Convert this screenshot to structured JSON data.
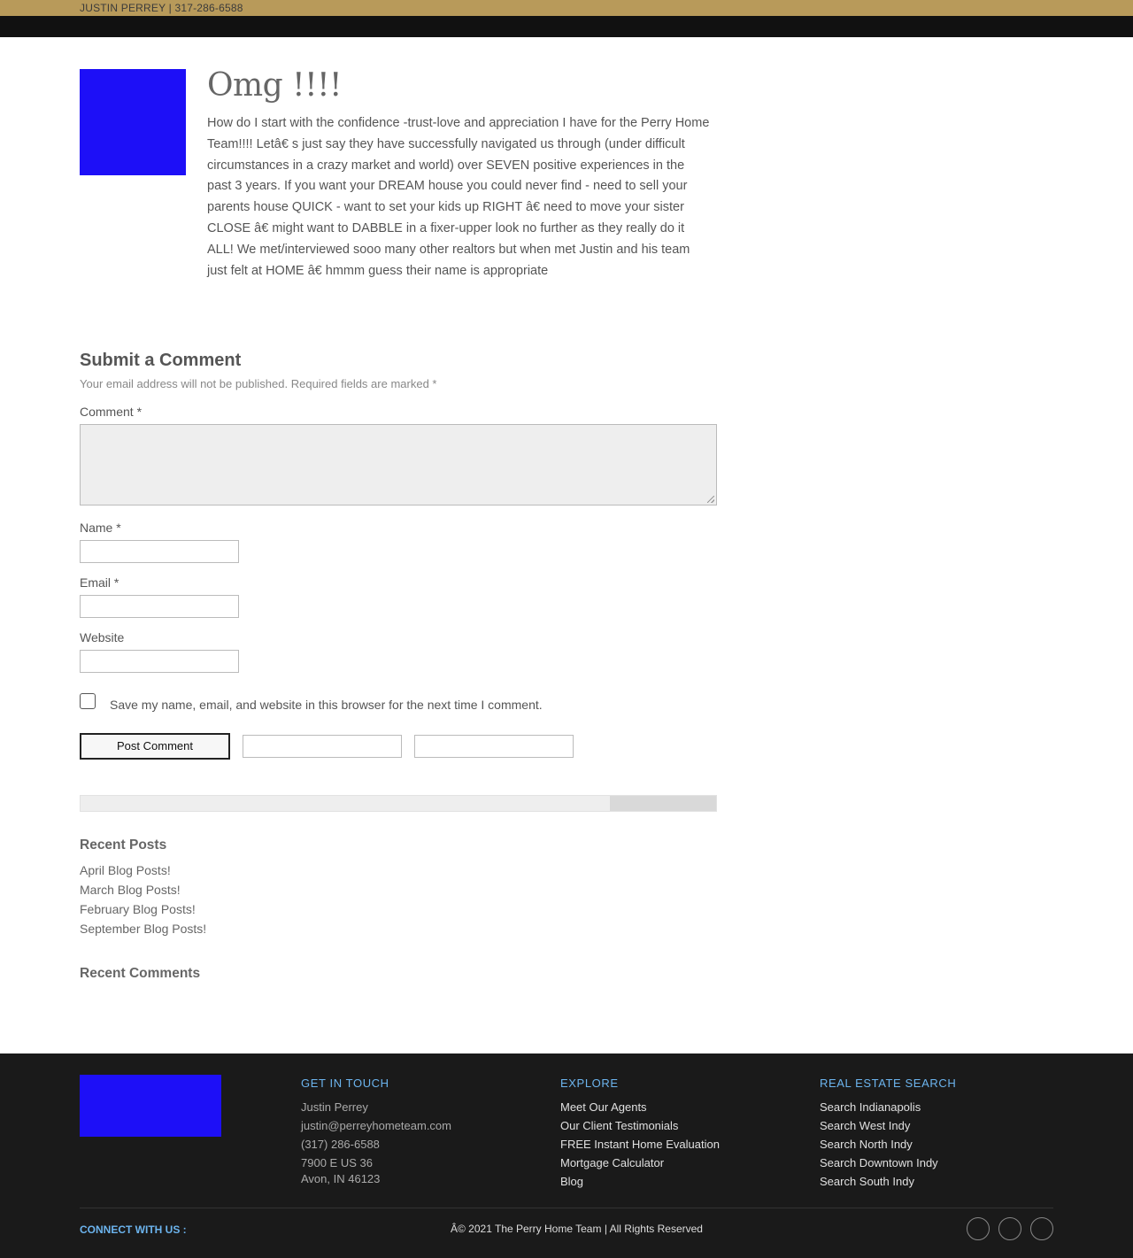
{
  "topbar": {
    "contact": "JUSTIN PERREY | 317-286-6588"
  },
  "post": {
    "title": "Omg !!!!",
    "body": "How do I start with the confidence -trust-love and appreciation I have for the Perry Home Team!!!! Letâ€ s just say they have successfully navigated us through (under difficult circumstances in a crazy market and world) over SEVEN positive experiences in the past 3 years. If you want your DREAM house you could never find - need to sell your parents house QUICK - want to set your kids up RIGHT â€ need to move your sister CLOSE â€ might want to DABBLE in a fixer-upper look no further as they really do it ALL! We met/interviewed sooo many other realtors but when met Justin and his team just felt at HOME â€ hmmm guess their name is appropriate"
  },
  "comment_form": {
    "heading": "Submit a Comment",
    "notes": "Your email address will not be published. Required fields are marked *",
    "comment_label": "Comment *",
    "name_label": "Name *",
    "email_label": "Email *",
    "website_label": "Website",
    "save_label": "Save my name, email, and website in this browser for the next time I comment.",
    "submit_label": "Post Comment"
  },
  "sidebar": {
    "recent_posts_title": "Recent Posts",
    "recent_posts": [
      "April Blog Posts!",
      "March Blog Posts!",
      "February Blog Posts!",
      "September Blog Posts!"
    ],
    "recent_comments_title": "Recent Comments"
  },
  "footer": {
    "get_in_touch": {
      "title": "GET IN TOUCH",
      "name": "Justin Perrey",
      "email": "justin@perreyhometeam.com",
      "phone": "(317) 286-6588",
      "address_line1": "7900 E US 36",
      "address_line2": "Avon, IN 46123"
    },
    "explore": {
      "title": "EXPLORE",
      "links": [
        "Meet Our Agents",
        "Our Client Testimonials",
        "FREE Instant Home Evaluation",
        "Mortgage Calculator",
        "Blog"
      ]
    },
    "real_estate_search": {
      "title": "REAL ESTATE SEARCH",
      "links": [
        "Search Indianapolis",
        "Search West Indy",
        "Search North Indy",
        "Search Downtown Indy",
        "Search South Indy"
      ]
    },
    "connect": "CONNECT WITH US :",
    "copyright": "Â© 2021 The Perry Home Team | All Rights Reserved"
  },
  "colors": {
    "brand_gold": "#b89a5a",
    "placeholder_blue": "#1d0ff7",
    "footer_heading": "#6cb4ee",
    "footer_bg": "#1a1a1a"
  }
}
